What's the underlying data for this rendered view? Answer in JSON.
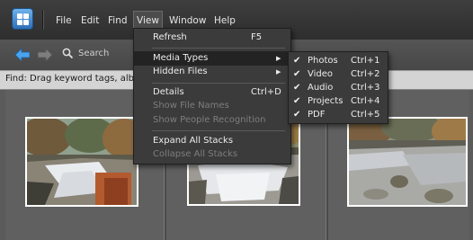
{
  "menubar": {
    "items": [
      "File",
      "Edit",
      "Find",
      "View",
      "Window",
      "Help"
    ],
    "active": "View"
  },
  "toolbar": {
    "back_icon": "left-arrow-icon",
    "forward_icon": "right-arrow-icon",
    "search_icon": "magnifier-icon",
    "search_label": "Search"
  },
  "findbar": {
    "text": "Find: Drag keyword tags, albu"
  },
  "view_menu": {
    "items": [
      {
        "label": "Refresh",
        "shortcut": "F5",
        "disabled": false
      },
      {
        "label": "Media Types",
        "submenu": true,
        "highlight": true
      },
      {
        "label": "Hidden Files",
        "submenu": true
      },
      {
        "label": "Details",
        "shortcut": "Ctrl+D",
        "disabled": false
      },
      {
        "label": "Show File Names",
        "disabled": true
      },
      {
        "label": "Show People Recognition",
        "disabled": true
      },
      {
        "label": "Expand All Stacks",
        "disabled": false
      },
      {
        "label": "Collapse All Stacks",
        "disabled": true
      }
    ]
  },
  "media_types_menu": {
    "items": [
      {
        "label": "Photos",
        "shortcut": "Ctrl+1",
        "checked": true
      },
      {
        "label": "Video",
        "shortcut": "Ctrl+2",
        "checked": true
      },
      {
        "label": "Audio",
        "shortcut": "Ctrl+3",
        "checked": true
      },
      {
        "label": "Projects",
        "shortcut": "Ctrl+4",
        "checked": true
      },
      {
        "label": "PDF",
        "shortcut": "Ctrl+5",
        "checked": true
      }
    ]
  },
  "colors": {
    "menubar_bg": "#353535",
    "menu_bg": "#3b3b3b",
    "menu_highlight": "#232323",
    "accent_blue": "#3a8fd9"
  }
}
